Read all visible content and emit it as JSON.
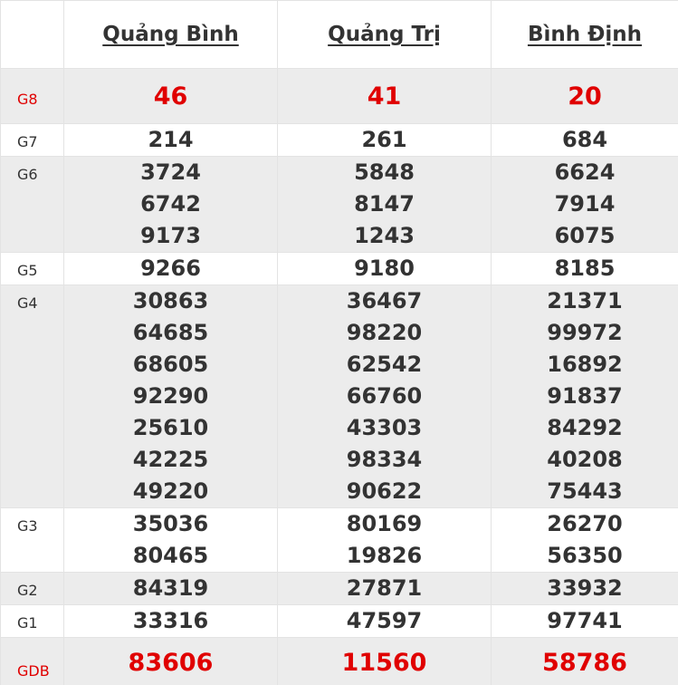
{
  "provinces": [
    "Quảng Bình",
    "Quảng Trị",
    "Bình Định"
  ],
  "prizes": [
    {
      "label": "G8",
      "values": [
        [
          "46"
        ],
        [
          "41"
        ],
        [
          "20"
        ]
      ]
    },
    {
      "label": "G7",
      "values": [
        [
          "214"
        ],
        [
          "261"
        ],
        [
          "684"
        ]
      ]
    },
    {
      "label": "G6",
      "values": [
        [
          "3724",
          "6742",
          "9173"
        ],
        [
          "5848",
          "8147",
          "1243"
        ],
        [
          "6624",
          "7914",
          "6075"
        ]
      ]
    },
    {
      "label": "G5",
      "values": [
        [
          "9266"
        ],
        [
          "9180"
        ],
        [
          "8185"
        ]
      ]
    },
    {
      "label": "G4",
      "values": [
        [
          "30863",
          "64685",
          "68605",
          "92290",
          "25610",
          "42225",
          "49220"
        ],
        [
          "36467",
          "98220",
          "62542",
          "66760",
          "43303",
          "98334",
          "90622"
        ],
        [
          "21371",
          "99972",
          "16892",
          "91837",
          "84292",
          "40208",
          "75443"
        ]
      ]
    },
    {
      "label": "G3",
      "values": [
        [
          "35036",
          "80465"
        ],
        [
          "80169",
          "19826"
        ],
        [
          "26270",
          "56350"
        ]
      ]
    },
    {
      "label": "G2",
      "values": [
        [
          "84319"
        ],
        [
          "27871"
        ],
        [
          "33932"
        ]
      ]
    },
    {
      "label": "G1",
      "values": [
        [
          "33316"
        ],
        [
          "47597"
        ],
        [
          "97741"
        ]
      ]
    },
    {
      "label": "GDB",
      "values": [
        [
          "83606"
        ],
        [
          "11560"
        ],
        [
          "58786"
        ]
      ]
    }
  ]
}
